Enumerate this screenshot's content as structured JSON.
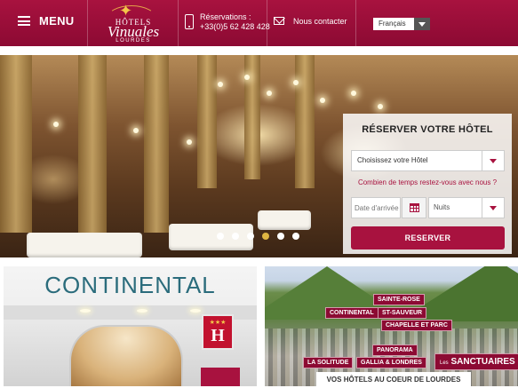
{
  "header": {
    "menu_label": "MENU",
    "logo": {
      "line1": "HÔTELS",
      "line2": "Vinuales",
      "line3": "LOURDES"
    },
    "reservations_label": "Réservations :",
    "reservations_phone": "+33(0)5 62 428 428",
    "contact_label": "Nous contacter",
    "language": "Français"
  },
  "hero": {
    "slide_count": 6,
    "active_slide": 4
  },
  "booking": {
    "title": "RÉSERVER VOTRE HÔTEL",
    "hotel_select": "Choisissez votre Hôtel",
    "stay_link": "Combien de temps restez-vous avec nous ?",
    "date_placeholder": "Date d'arrivée",
    "nights_label": "Nuits",
    "reserve_label": "RESERVER"
  },
  "cards": {
    "left": {
      "sign": "CONTINENTAL",
      "stars": "★★★",
      "letter": "H"
    },
    "right": {
      "caption": "VOS HÔTELS AU COEUR DE LOURDES",
      "tags": [
        "SAINTE-ROSE",
        "CONTINENTAL",
        "ST-SAUVEUR",
        "CHAPELLE ET PARC",
        "PANORAMA",
        "LA SOLITUDE",
        "GALLIA & LONDRES",
        "SANCTUAIRES",
        "Les"
      ]
    }
  },
  "colors": {
    "brand": "#a8123f",
    "accent": "#e0b642"
  }
}
